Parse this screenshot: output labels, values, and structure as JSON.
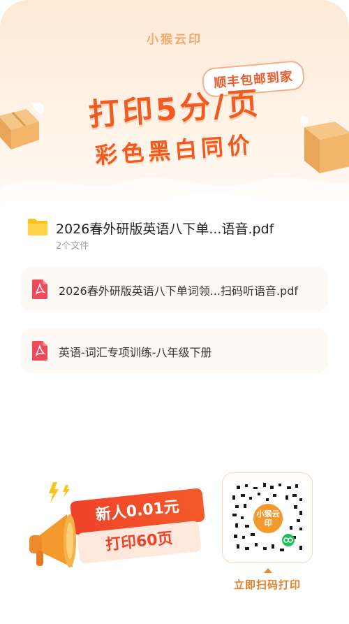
{
  "brand": {
    "name": "小猴云印"
  },
  "hero": {
    "tag": "顺丰包邮到家",
    "headline": "打印5分/页",
    "subheadline": "彩色黑白同价"
  },
  "folder": {
    "name": "2026春外研版英语八下单...语音.pdf",
    "count": "2个文件"
  },
  "files": [
    {
      "name": "2026春外研版英语八下单词领...扫码听语音.pdf"
    },
    {
      "name": "英语-词汇专项训练-八年级下册"
    }
  ],
  "promo": {
    "line1": "新人0.01元",
    "line2": "打印60页"
  },
  "qr": {
    "logo_text": "小猴云印",
    "caption": "立即扫码打印"
  },
  "colors": {
    "accent": "#f25a22",
    "pdf": "#ef4a5a",
    "folder": "#ffc21a"
  },
  "icons": [
    "folder-icon",
    "pdf-icon",
    "megaphone-icon",
    "package-icon",
    "qr-code-icon"
  ]
}
